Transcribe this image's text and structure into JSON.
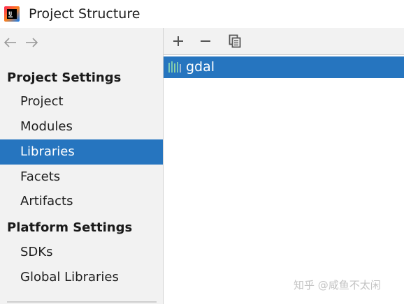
{
  "window": {
    "title": "Project Structure"
  },
  "sidebar": {
    "nav": {
      "back_icon": "arrow-left-icon",
      "forward_icon": "arrow-right-icon"
    },
    "sections": [
      {
        "header": "Project Settings",
        "items": [
          {
            "label": "Project",
            "selected": false
          },
          {
            "label": "Modules",
            "selected": false
          },
          {
            "label": "Libraries",
            "selected": true
          },
          {
            "label": "Facets",
            "selected": false
          },
          {
            "label": "Artifacts",
            "selected": false
          }
        ]
      },
      {
        "header": "Platform Settings",
        "items": [
          {
            "label": "SDKs",
            "selected": false
          },
          {
            "label": "Global Libraries",
            "selected": false
          }
        ]
      }
    ]
  },
  "toolbar": {
    "buttons": [
      {
        "icon": "plus-icon"
      },
      {
        "icon": "minus-icon"
      },
      {
        "icon": "copy-icon"
      }
    ]
  },
  "libraries": [
    {
      "name": "gdal",
      "icon": "library-icon",
      "selected": true
    }
  ],
  "watermark": "知乎 @咸鱼不太闲",
  "colors": {
    "selection": "#2675bf",
    "sidebar_bg": "#f2f2f2",
    "library_icon": "#5fb0a8"
  }
}
